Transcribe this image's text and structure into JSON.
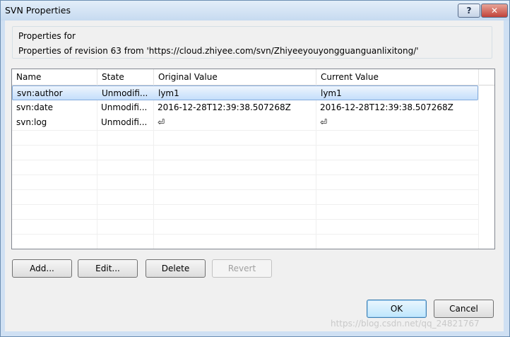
{
  "window": {
    "title": "SVN Properties",
    "help_label": "?",
    "close_label": "✕"
  },
  "group": {
    "label": "Properties for",
    "text": "Properties of revision 63 from 'https://cloud.zhiyee.com/svn/Zhiyeeyouyongguanguanlixitong/'"
  },
  "table": {
    "columns": [
      "Name",
      "State",
      "Original Value",
      "Current Value"
    ],
    "rows": [
      {
        "name": "svn:author",
        "state": "Unmodifi...",
        "original": "lym1",
        "current": "lym1",
        "selected": true
      },
      {
        "name": "svn:date",
        "state": "Unmodifi...",
        "original": "2016-12-28T12:39:38.507268Z",
        "current": "2016-12-28T12:39:38.507268Z",
        "selected": false
      },
      {
        "name": "svn:log",
        "state": "Unmodifi...",
        "original": "⏎",
        "current": "⏎",
        "selected": false
      }
    ]
  },
  "buttons": {
    "add": "Add...",
    "edit": "Edit...",
    "delete": "Delete",
    "revert": "Revert",
    "ok": "OK",
    "cancel": "Cancel"
  },
  "watermark": "https://blog.csdn.net/qq_24821767"
}
